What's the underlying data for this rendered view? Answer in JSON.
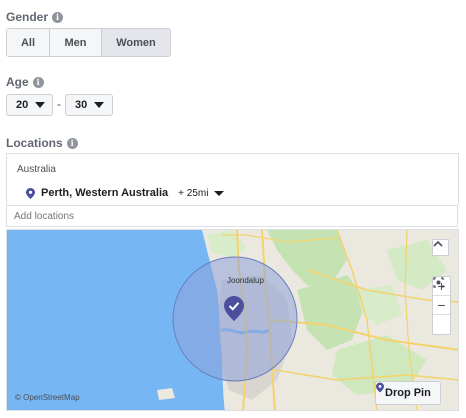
{
  "gender": {
    "label": "Gender",
    "options": [
      "All",
      "Men",
      "Women"
    ],
    "selected": "Women"
  },
  "age": {
    "label": "Age",
    "min": "20",
    "max": "30",
    "separator": "-"
  },
  "locations": {
    "label": "Locations",
    "country": "Australia",
    "location_name": "Perth, Western Australia",
    "radius": "+ 25mi",
    "add_placeholder": "Add locations"
  },
  "map": {
    "city_label": "Joondalup",
    "attribution": "© OpenStreetMap",
    "drop_pin_label": "Drop Pin",
    "zoom_in": "+",
    "zoom_out": "−"
  },
  "colors": {
    "accent": "#4a4f9e",
    "water": "#76b6f4",
    "radius_fill": "#8ea2d8"
  },
  "icons": [
    "info-icon",
    "caret-down-icon",
    "map-pin-icon",
    "chevron-up-icon",
    "recenter-icon"
  ]
}
